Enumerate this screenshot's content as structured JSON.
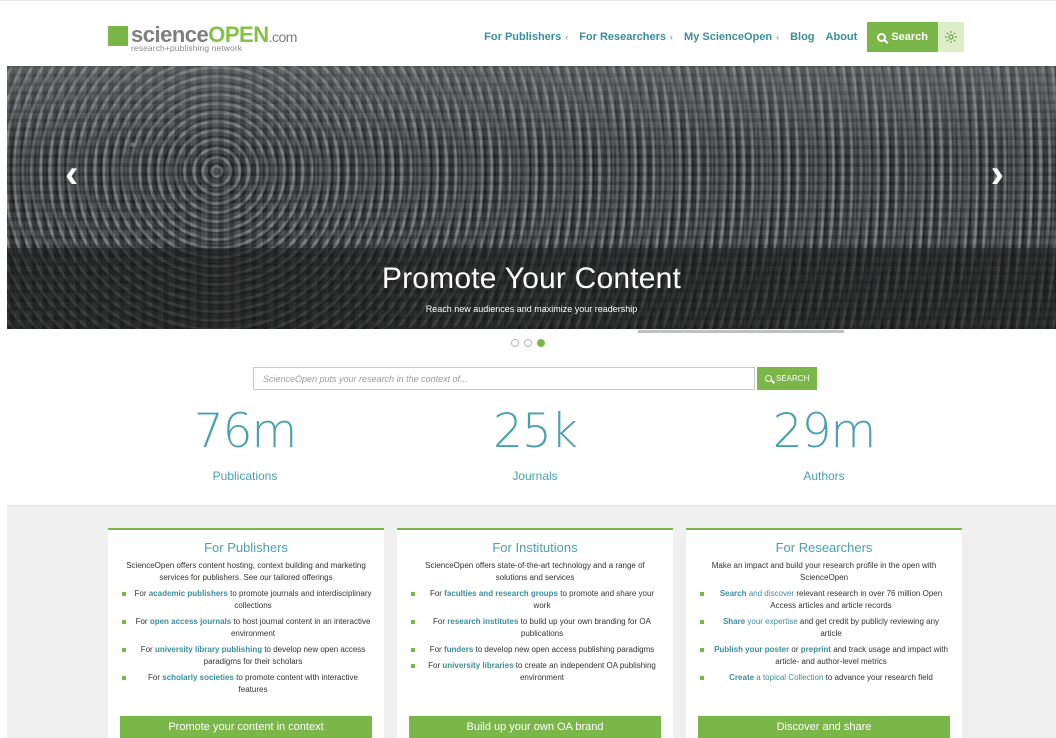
{
  "header": {
    "logo_main_a": "science",
    "logo_main_b": "OPEN",
    "logo_com": ".com",
    "logo_tagline": "research+publishing network",
    "nav": [
      {
        "label": "For Publishers",
        "dropdown": true
      },
      {
        "label": "For Researchers",
        "dropdown": true
      },
      {
        "label": "My ScienceOpen",
        "dropdown": true
      },
      {
        "label": "Blog",
        "dropdown": false
      },
      {
        "label": "About",
        "dropdown": false
      }
    ],
    "search_label": "Search",
    "settings_icon": "gear-icon",
    "chevron_glyph": "‹"
  },
  "hero": {
    "title": "Promote Your Content",
    "subtitle": "Reach new audiences and maximize your readership",
    "prev_glyph": "‹",
    "next_glyph": "›",
    "slide_count": 3,
    "active_slide": 3
  },
  "search": {
    "placeholder": "ScienceOpen puts your research in the context of...",
    "button_label": "SEARCH"
  },
  "stats": [
    {
      "value": "76m",
      "label": "Publications"
    },
    {
      "value": "25k",
      "label": "Journals"
    },
    {
      "value": "29m",
      "label": "Authors"
    }
  ],
  "colors": {
    "accent_green": "#7ab648",
    "link_teal": "#3b8e9c",
    "stat_teal": "#4aa0ad"
  },
  "cards": [
    {
      "title": "For Publishers",
      "description": "ScienceOpen offers content hosting, context building and marketing services for publishers. See our tailored offerings",
      "items": [
        {
          "pre": "For ",
          "hl": "academic publishers",
          "post": " to promote journals and interdisciplinary collections"
        },
        {
          "pre": "For ",
          "hl": "open access journals",
          "post": " to host journal content in an interactive environment"
        },
        {
          "pre": "For ",
          "hl": "university library publishing",
          "post": " to develop new open access paradigms for their scholars"
        },
        {
          "pre": "For ",
          "hl": "scholarly societies",
          "post": " to promote content with interactive features"
        }
      ],
      "cta": "Promote your content in context"
    },
    {
      "title": "For Institutions",
      "description": "ScienceOpen offers state-of-the-art technology and a range of solutions and services",
      "items": [
        {
          "pre": "For ",
          "hl": "faculties and research groups",
          "post": " to promote and share your work"
        },
        {
          "pre": "For ",
          "hl": "research institutes",
          "post": " to build up your own branding for OA publications"
        },
        {
          "pre": "For ",
          "hl": "funders",
          "post": " to develop new open access publishing paradigms"
        },
        {
          "pre": "For ",
          "hl": "university libraries",
          "post": " to create an independent OA publishing environment"
        }
      ],
      "cta": "Build up your own OA brand"
    },
    {
      "title": "For Researchers",
      "description": "Make an impact and build your research profile in the open with ScienceOpen",
      "items": [
        {
          "pre": "",
          "hl": "Search",
          "mid": " and discover",
          "post": " relevant research in over 76 million Open Access articles and article records"
        },
        {
          "pre": "",
          "hl": "Share",
          "mid": " your expertise",
          "post": " and get credit by publicly reviewing any article"
        },
        {
          "pre": "",
          "hl": "Publish your poster",
          "mid": " or ",
          "hl2": "preprint",
          "post": " and track usage and impact with article- and author-level metrics"
        },
        {
          "pre": "",
          "hl": "Create",
          "mid": " a topical Collection",
          "post": " to advance your research field"
        }
      ],
      "cta": "Discover and share"
    }
  ]
}
